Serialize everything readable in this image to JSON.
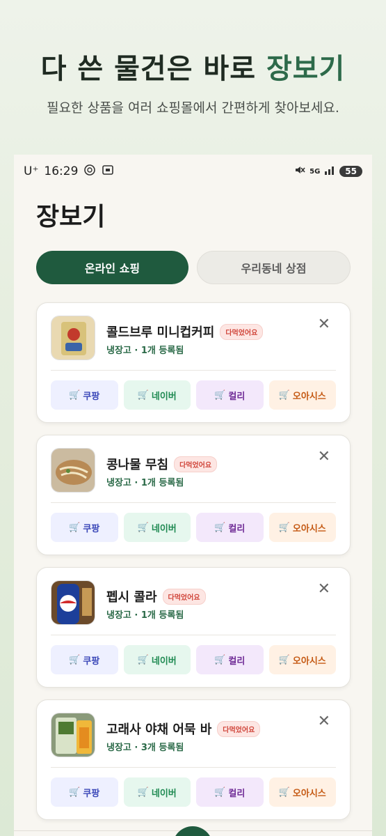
{
  "hero": {
    "title_main": "다 쓴 물건은 바로 ",
    "title_accent": "장보기",
    "subtitle": "필요한 상품을 여러 쇼핑몰에서 간편하게 찾아보세요."
  },
  "status_bar": {
    "carrier": "U⁺",
    "time": "16:29",
    "network": "5G",
    "battery": "55"
  },
  "page_title": "장보기",
  "tabs": [
    {
      "label": "온라인 쇼핑",
      "active": true
    },
    {
      "label": "우리동네 상점",
      "active": false
    }
  ],
  "badge_text": "다먹었어요",
  "shops": {
    "coupang": "쿠팡",
    "naver": "네이버",
    "kurly": "컬리",
    "oasis": "오아시스"
  },
  "items": [
    {
      "name": "콜드브루 미니컵커피",
      "meta": "냉장고 · 1개 등록됨"
    },
    {
      "name": "콩나물 무침",
      "meta": "냉장고 · 1개 등록됨"
    },
    {
      "name": "펩시 콜라",
      "meta": "냉장고 · 1개 등록됨"
    },
    {
      "name": "고래사 야채 어묵 바",
      "meta": "냉장고 · 3개 등록됨"
    }
  ],
  "colors": {
    "brand_green": "#1f5a3e",
    "badge_red": "#d0453a"
  }
}
